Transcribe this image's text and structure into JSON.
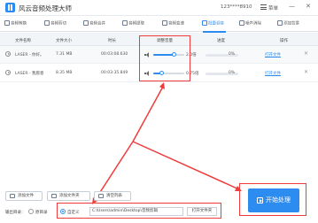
{
  "app": {
    "title": "风云音频处理大师",
    "user": "123****8910",
    "menu": "菜单",
    "minimize": "—",
    "close": "✕"
  },
  "toolbar": {
    "items": [
      {
        "label": "音频转换",
        "icon": "convert-icon"
      },
      {
        "label": "音频剪切",
        "icon": "cut-icon"
      },
      {
        "label": "音频合并",
        "icon": "merge-icon"
      },
      {
        "label": "音频提取",
        "icon": "extract-icon"
      },
      {
        "label": "音频变速",
        "icon": "speed-icon"
      },
      {
        "label": "批量调音",
        "icon": "volume-icon",
        "active": true
      },
      {
        "label": "噪声消除",
        "icon": "noise-icon"
      },
      {
        "label": "添加背景",
        "icon": "background-icon"
      }
    ]
  },
  "table": {
    "headers": [
      "文件名称",
      "文件大小",
      "时长",
      "调整音量",
      "进度",
      "操作"
    ],
    "rows": [
      {
        "name": "LASER - 你好。",
        "size": "7.31 MB",
        "duration": "00:03:08.630",
        "volume": 2.0,
        "volume_label": "2.0倍",
        "progress_pct": 0,
        "progress": "0%",
        "action": "打开文件",
        "remove": "✕"
      },
      {
        "name": "LASER - 我愿意",
        "size": "8.35 MB",
        "duration": "00:03:35.849",
        "volume": 0.75,
        "volume_label": "0.75倍",
        "progress_pct": 0,
        "progress": "0%",
        "action": "打开文件",
        "remove": "✕"
      }
    ]
  },
  "slider_max": 3,
  "bottom": {
    "add_file": "添加文件",
    "add_folder": "添加文件夹",
    "clear_list": "清空列表"
  },
  "output": {
    "label": "输出目录：",
    "original": "原目录",
    "custom": "自定义",
    "path": "C:\\Users\\admin\\Desktop\\音频剪辑",
    "open_folder": "打开文件夹"
  },
  "start": {
    "label": "开始处理"
  },
  "colors": {
    "accent": "#2d8cf0",
    "highlight": "#f03c3c"
  }
}
